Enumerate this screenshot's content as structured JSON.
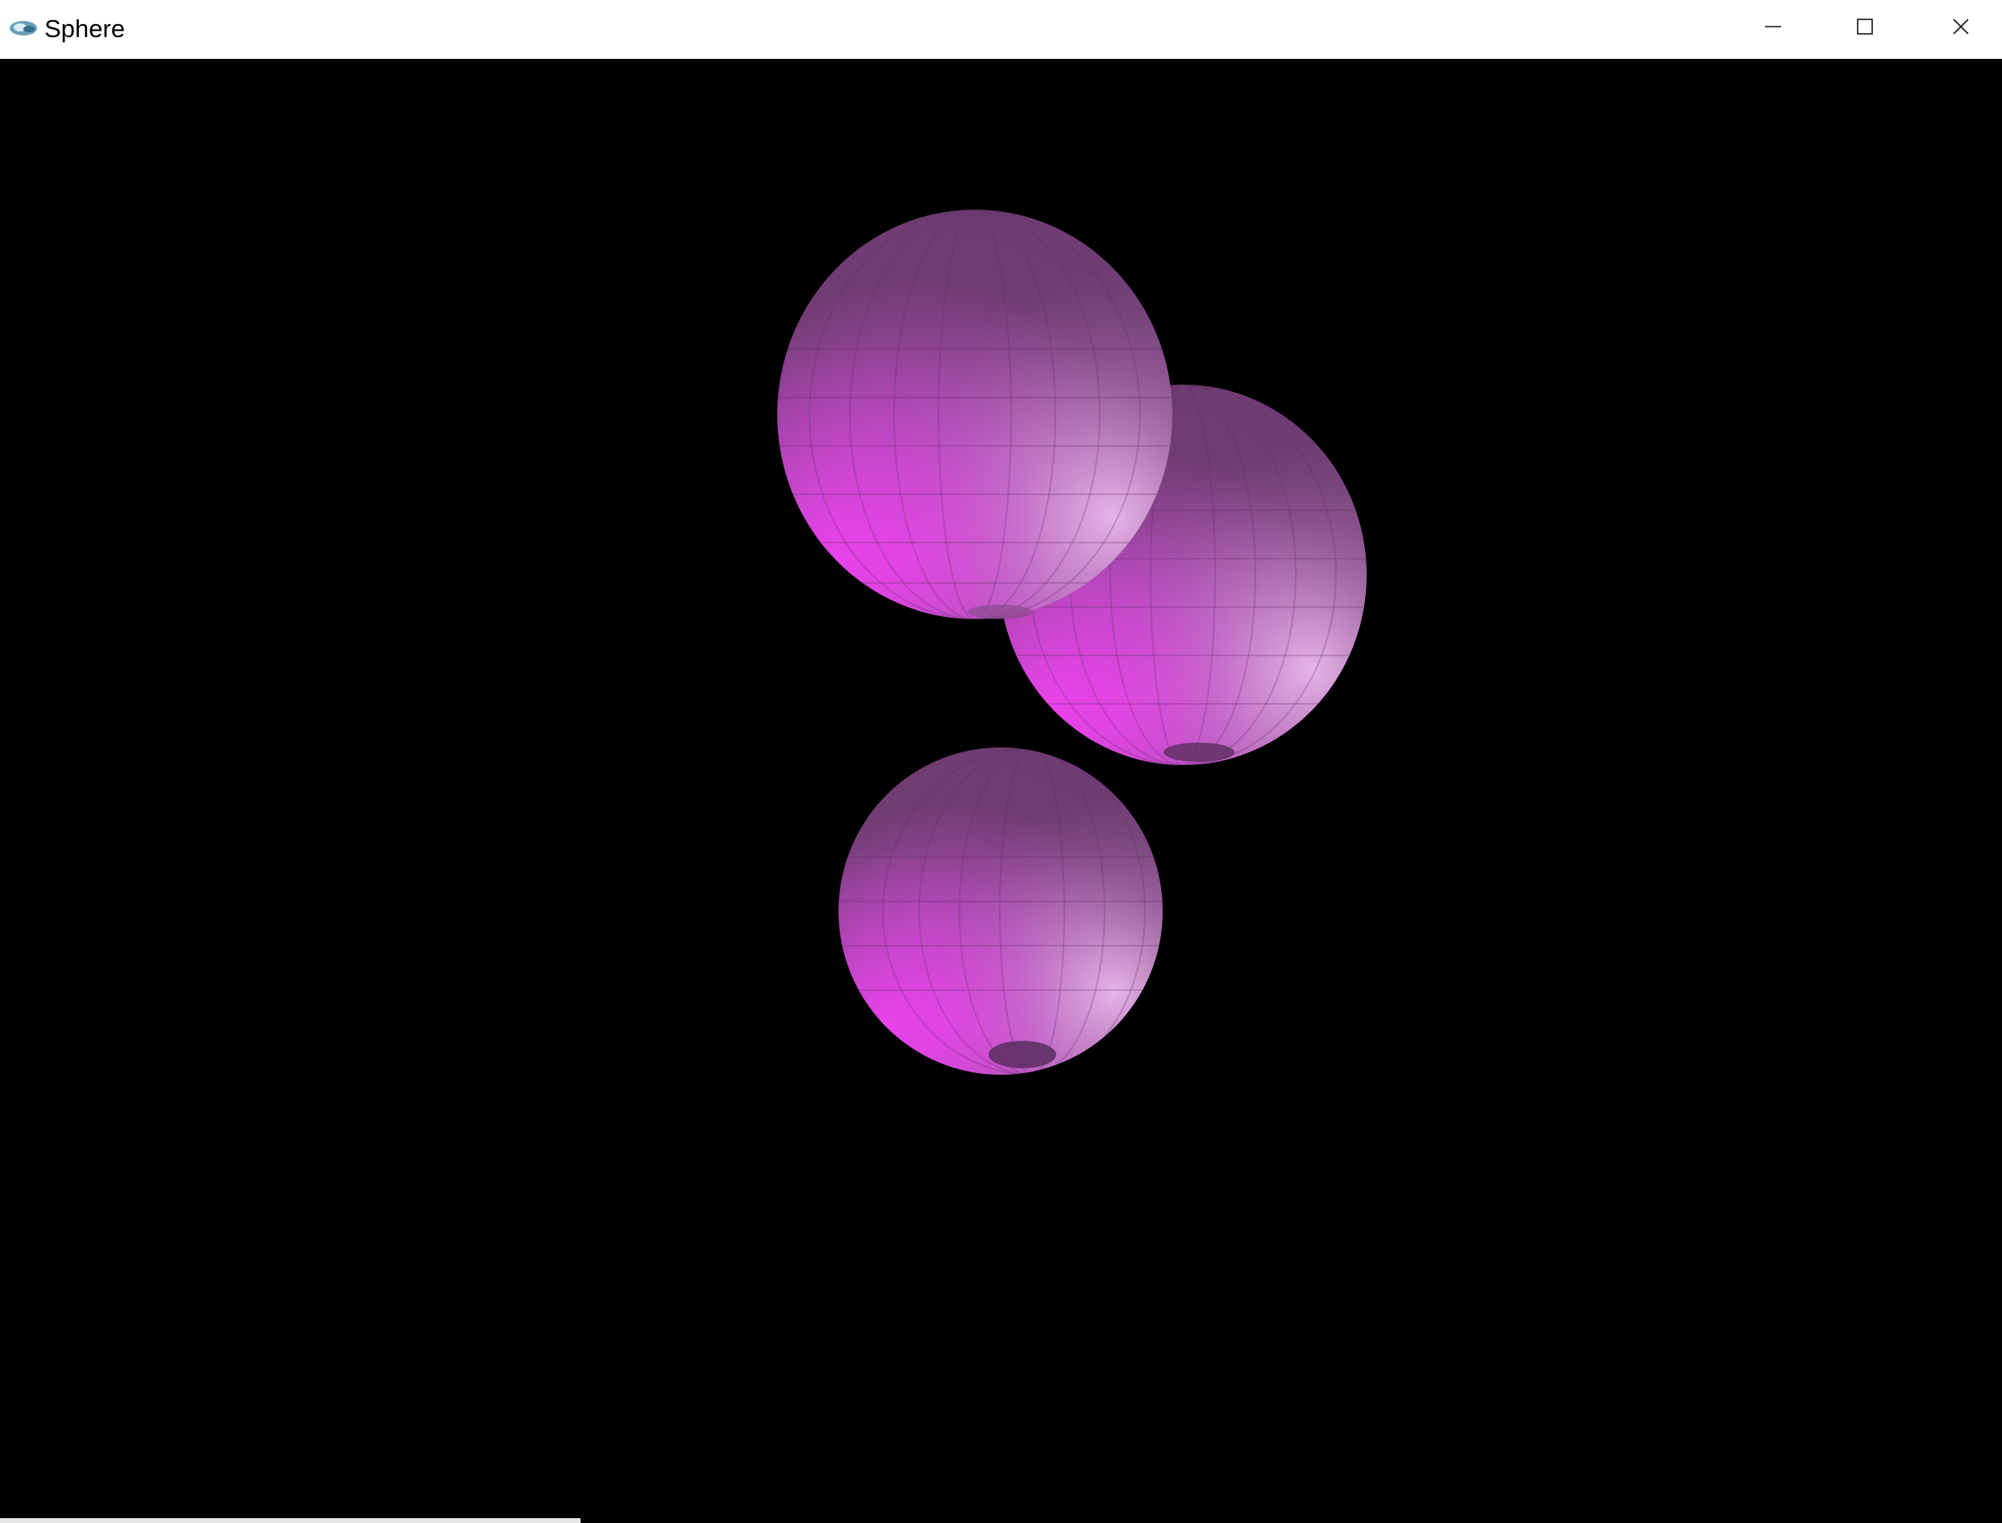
{
  "window": {
    "title": "Sphere",
    "icon": "opengl-app-icon",
    "controls": {
      "minimize_icon": "minimize-icon",
      "maximize_icon": "maximize-icon",
      "close_icon": "close-icon"
    }
  },
  "scene": {
    "background_color": "#000000",
    "sphere_color": "#b04ab8",
    "highlight_color": "#e43ae8",
    "spheres": [
      {
        "name": "upper-left-sphere"
      },
      {
        "name": "right-sphere"
      },
      {
        "name": "lower-sphere"
      }
    ]
  }
}
